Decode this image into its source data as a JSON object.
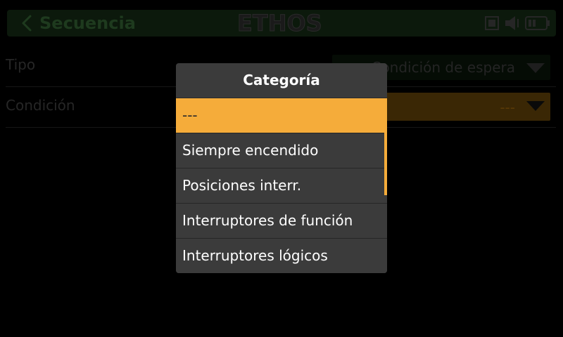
{
  "header": {
    "title": "Secuencia",
    "logo_text": "ETHOS",
    "icons": [
      "back-icon",
      "sd-card-icon",
      "speaker-icon",
      "battery-icon"
    ]
  },
  "rows": [
    {
      "label": "Tipo",
      "value": "Condición de espera"
    },
    {
      "label": "Condición",
      "value": "---"
    }
  ],
  "modal": {
    "title": "Categoría",
    "items": [
      "---",
      "Siempre encendido",
      "Posiciones interr.",
      "Interruptores de función",
      "Interruptores lógicos"
    ],
    "selected_index": 0
  },
  "colors": {
    "accent": "#f5ac3a",
    "modal_bg": "#3b3b3b",
    "header_bg": "#0c190c"
  }
}
